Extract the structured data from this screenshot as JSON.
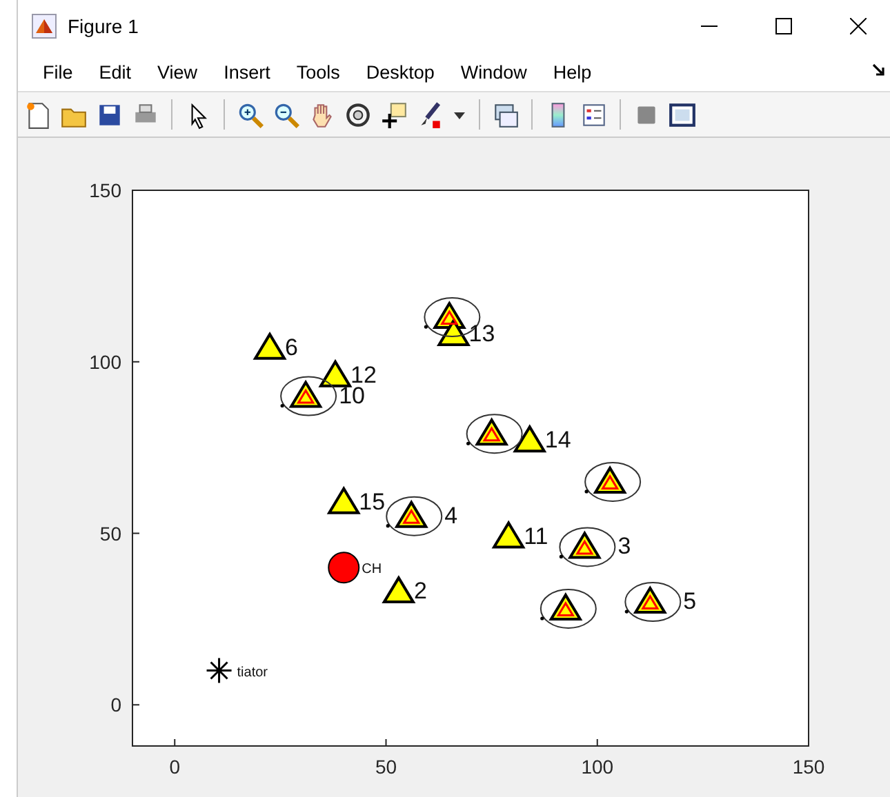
{
  "window": {
    "title": "Figure 1"
  },
  "menu": [
    "File",
    "Edit",
    "View",
    "Insert",
    "Tools",
    "Desktop",
    "Window",
    "Help"
  ],
  "chart_data": {
    "type": "scatter",
    "xlim": [
      -10,
      150
    ],
    "ylim": [
      -12,
      150
    ],
    "xticks": [
      0,
      50,
      100,
      150
    ],
    "yticks": [
      0,
      50,
      100,
      150
    ],
    "series": [
      {
        "color": "#ffff00",
        "x": [
          22.5,
          38,
          31,
          65,
          66,
          75,
          84,
          40,
          56,
          79,
          97,
          103,
          53,
          92.5,
          112.5
        ],
        "values": [
          104,
          96,
          90,
          113,
          108,
          79,
          77,
          59,
          55,
          49,
          46,
          65,
          33,
          28,
          30
        ]
      },
      {
        "color": "#ff0000",
        "x": [
          31,
          65,
          75,
          56,
          97,
          103,
          92.5,
          112.5
        ],
        "values": [
          90,
          113,
          79,
          55,
          46,
          65,
          28,
          30
        ]
      },
      {
        "color": "#ff0000",
        "x": [
          40
        ],
        "values": [
          40
        ]
      },
      {
        "color": "#000000",
        "x": [
          10.5
        ],
        "values": [
          10
        ]
      }
    ],
    "annotations": [
      {
        "text": "6",
        "x": 22.5,
        "y": 104
      },
      {
        "text": "12",
        "x": 38,
        "y": 96
      },
      {
        "text": "10",
        "x": 31,
        "y": 90
      },
      {
        "text": "13",
        "x": 66,
        "y": 108
      },
      {
        "text": "14",
        "x": 84,
        "y": 77
      },
      {
        "text": "15",
        "x": 40,
        "y": 59
      },
      {
        "text": "4",
        "x": 56,
        "y": 55
      },
      {
        "text": "11",
        "x": 79,
        "y": 49
      },
      {
        "text": "3",
        "x": 97,
        "y": 46
      },
      {
        "text": "2",
        "x": 53,
        "y": 33
      },
      {
        "text": "5",
        "x": 112.5,
        "y": 30
      },
      {
        "text": "CH",
        "x": 40,
        "y": 40
      },
      {
        "text": "tiator",
        "x": 10.5,
        "y": 10
      }
    ]
  }
}
